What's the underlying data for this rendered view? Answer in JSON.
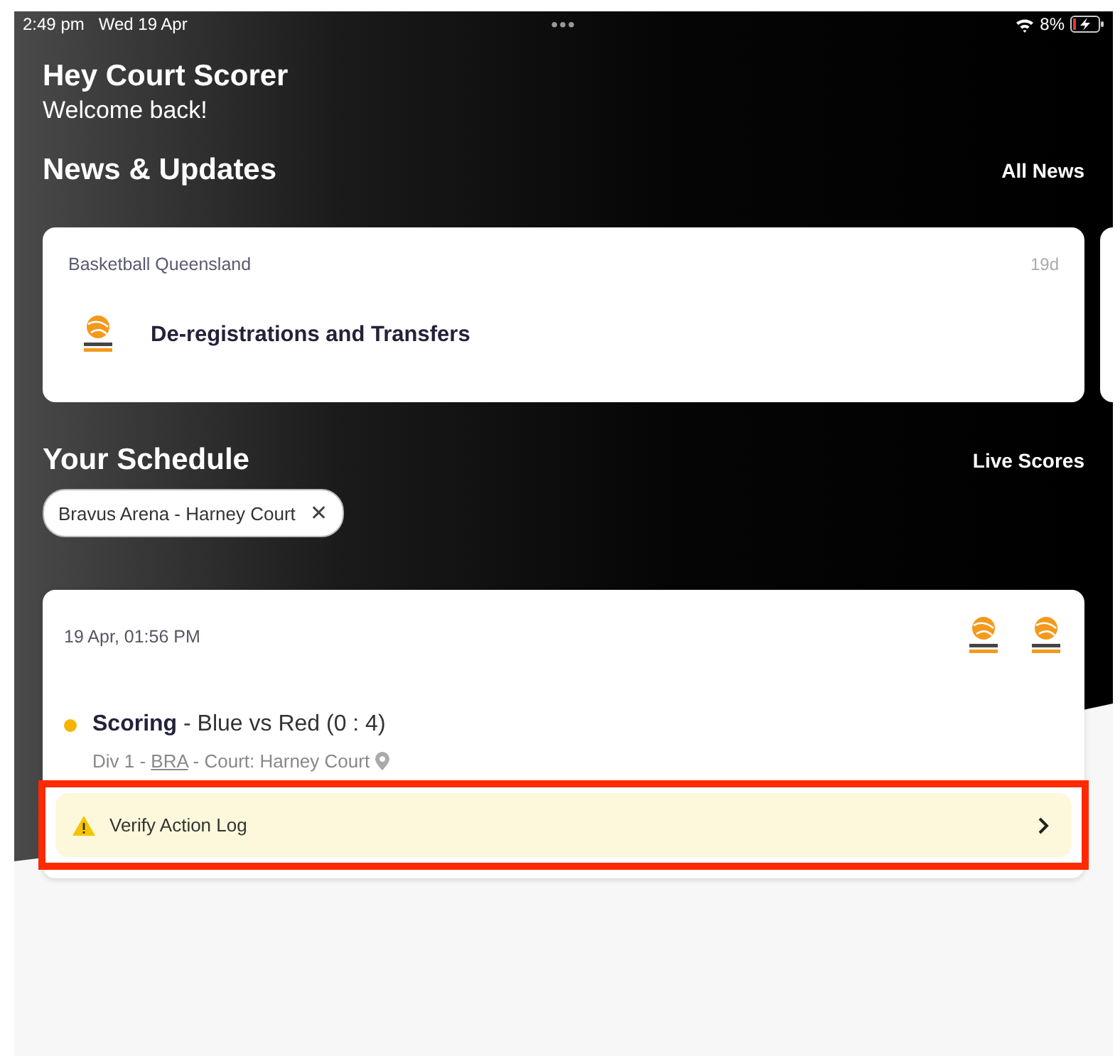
{
  "status_bar": {
    "time": "2:49 pm",
    "date": "Wed 19 Apr",
    "handle": "•••",
    "battery": "8%"
  },
  "greeting": {
    "title": "Hey Court Scorer",
    "subtitle": "Welcome back!"
  },
  "news": {
    "title": "News & Updates",
    "link": "All News",
    "items": [
      {
        "source": "Basketball Queensland",
        "age": "19d",
        "headline": "De-registrations and Transfers"
      }
    ]
  },
  "schedule": {
    "title": "Your Schedule",
    "link": "Live Scores",
    "filters": [
      {
        "label": "Bravus Arena - Harney Court",
        "close": "✕"
      }
    ],
    "games": [
      {
        "datetime": "19 Apr, 01:56 PM",
        "color": "#f5b400",
        "summary": "**Scoring** - Blue vs Red (0 : 4)",
        "meta_before": "Div 1 - ",
        "meta_link": "BRA",
        "meta_after": " - Court: Harney Court",
        "action": {
          "label": "Verify Action Log",
          "highlighted": true
        }
      }
    ]
  }
}
